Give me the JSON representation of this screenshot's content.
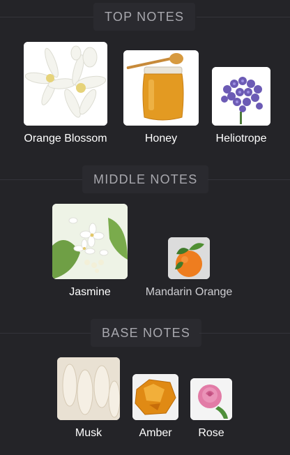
{
  "sections": {
    "top": {
      "title": "TOP NOTES",
      "notes": [
        {
          "label": "Orange Blossom",
          "icon": "orange-blossom-image"
        },
        {
          "label": "Honey",
          "icon": "honey-jar-image"
        },
        {
          "label": "Heliotrope",
          "icon": "heliotrope-flower-image"
        }
      ]
    },
    "middle": {
      "title": "MIDDLE NOTES",
      "notes": [
        {
          "label": "Jasmine",
          "icon": "jasmine-flower-image"
        },
        {
          "label": "Mandarin Orange",
          "icon": "mandarin-orange-image"
        }
      ]
    },
    "base": {
      "title": "BASE NOTES",
      "notes": [
        {
          "label": "Musk",
          "icon": "musk-image"
        },
        {
          "label": "Amber",
          "icon": "amber-image"
        },
        {
          "label": "Rose",
          "icon": "rose-image"
        }
      ]
    }
  },
  "colors": {
    "background": "#242428",
    "header_text": "#a8a8ae",
    "label_text": "#ffffff"
  }
}
